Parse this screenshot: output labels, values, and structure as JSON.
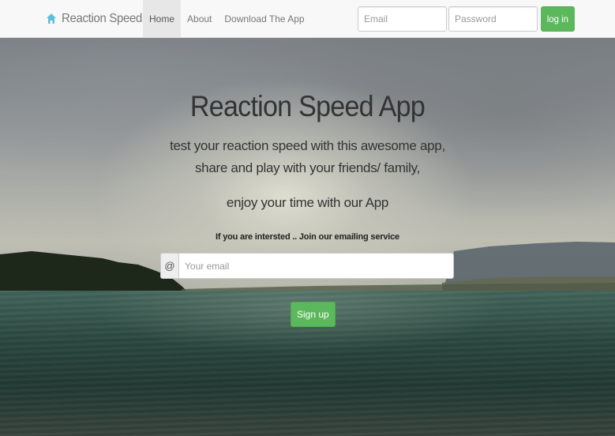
{
  "navbar": {
    "brand": "Reaction Speed App",
    "brand_icon": "home-icon",
    "links": [
      {
        "label": "Home",
        "active": true
      },
      {
        "label": "About",
        "active": false
      },
      {
        "label": "Download The App",
        "active": false
      }
    ],
    "login": {
      "email_placeholder": "Email",
      "password_placeholder": "Password",
      "button_label": "log in"
    }
  },
  "hero": {
    "title": "Reaction Speed App",
    "tagline": "test your reaction speed with this awesome app, share and play with your friends/ family,",
    "enjoy": "enjoy your time with our App",
    "note": "If you are intersted .. Join our emailing service",
    "subscribe": {
      "addon": "@",
      "placeholder": "Your email",
      "button_label": "Sign up"
    }
  },
  "colors": {
    "navbar_bg": "#f8f8f8",
    "active_tab_bg": "#e7e7e7",
    "button_green": "#5cb85c",
    "brand_icon": "#5bc0de"
  }
}
